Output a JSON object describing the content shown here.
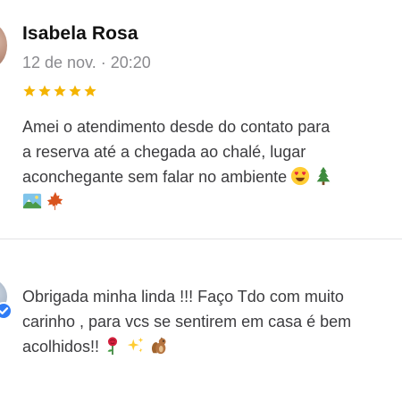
{
  "review": {
    "author_name": "Isabela Rosa",
    "timestamp": "12 de nov. · 20:20",
    "rating": 5,
    "text_lines": [
      "Amei o atendimento desde do contato para",
      "a reserva até a chegada ao chalé, lugar",
      "aconchegante sem falar no ambiente"
    ],
    "icons": {
      "avatar": "avatar-icon",
      "stars": "star-icon",
      "emojis": [
        "heart-eyes-emoji-icon",
        "pine-tree-emoji-icon",
        "landscape-emoji-icon",
        "maple-leaf-emoji-icon"
      ]
    }
  },
  "reply": {
    "text_lines": [
      "Obrigada minha linda !!! Faço Tdo com muito",
      "carinho , para vcs se sentirem em casa é bem",
      "acolhidos!!"
    ],
    "icons": {
      "avatar": "avatar-icon",
      "badge": "verified-badge-icon",
      "emojis": [
        "rose-emoji-icon",
        "sparkles-emoji-icon",
        "chipmunk-emoji-icon"
      ]
    }
  },
  "colors": {
    "star": "#f4b400",
    "verified": "#2f7cf6",
    "name_text": "#111111",
    "meta_text": "#8a8a8e",
    "body_text": "#3c3c3f",
    "divider": "#e3e3e6"
  }
}
